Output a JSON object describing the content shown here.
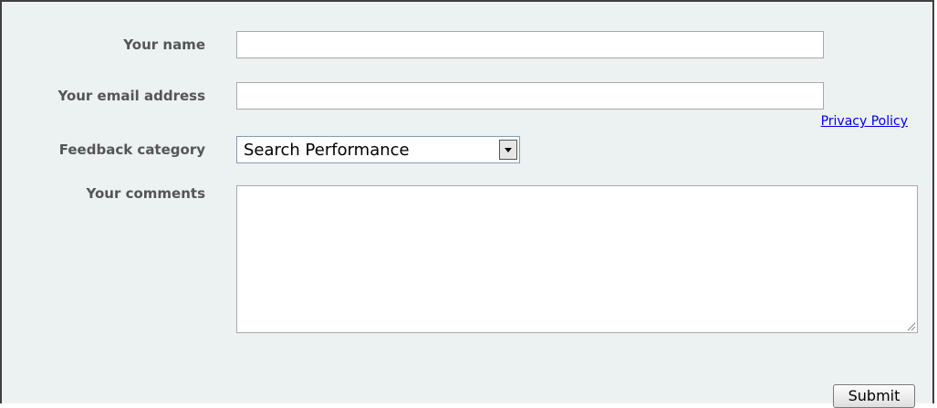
{
  "form": {
    "name_label": "Your name",
    "name_value": "",
    "email_label": "Your email address",
    "email_value": "",
    "privacy_link": "Privacy Policy",
    "category_label": "Feedback category",
    "category_selected": "Search Performance",
    "comments_label": "Your comments",
    "comments_value": "",
    "submit_label": "Submit"
  },
  "colors": {
    "panel_background": "#ecf1f1",
    "label_text": "#555555",
    "link": "#0000ee"
  }
}
